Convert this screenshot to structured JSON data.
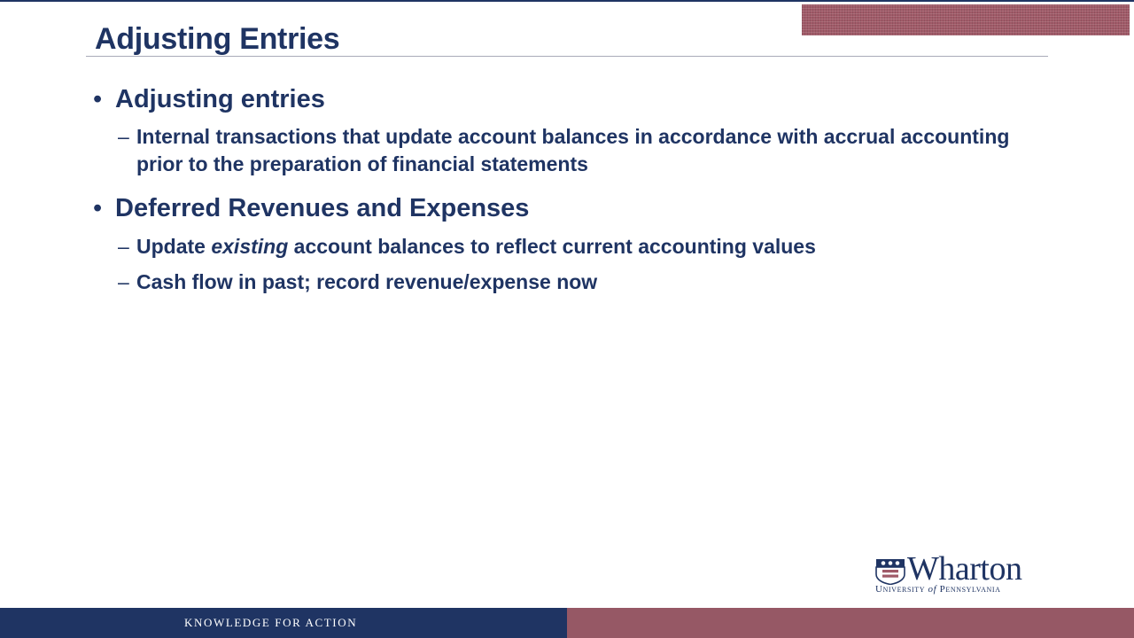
{
  "slide": {
    "title": "Adjusting Entries",
    "bullets": [
      {
        "bullet_glyph": "•",
        "text": "Adjusting entries",
        "subitems": [
          {
            "dash": "–",
            "text": "Internal transactions that update account balances in accordance with accrual accounting prior to the preparation of financial statements"
          }
        ]
      },
      {
        "bullet_glyph": "•",
        "text": "Deferred Revenues and Expenses",
        "subitems": [
          {
            "dash": "–",
            "text_before": "Update ",
            "text_emphasis": "existing",
            "text_after": " account balances to reflect current accounting values"
          },
          {
            "dash": "–",
            "text": "Cash flow in past; record revenue/expense now"
          }
        ]
      }
    ]
  },
  "branding": {
    "logo_name": "Wharton",
    "university_line_before": "University ",
    "university_line_of": "of",
    "university_line_after": " Pennsylvania",
    "footer_tagline": "KNOWLEDGE FOR ACTION"
  },
  "colors": {
    "navy": "#1f3463",
    "burgundy": "#965865",
    "rule_gray": "#a9aab8"
  },
  "icons": {
    "logo_shield": "penn-shield-icon"
  }
}
